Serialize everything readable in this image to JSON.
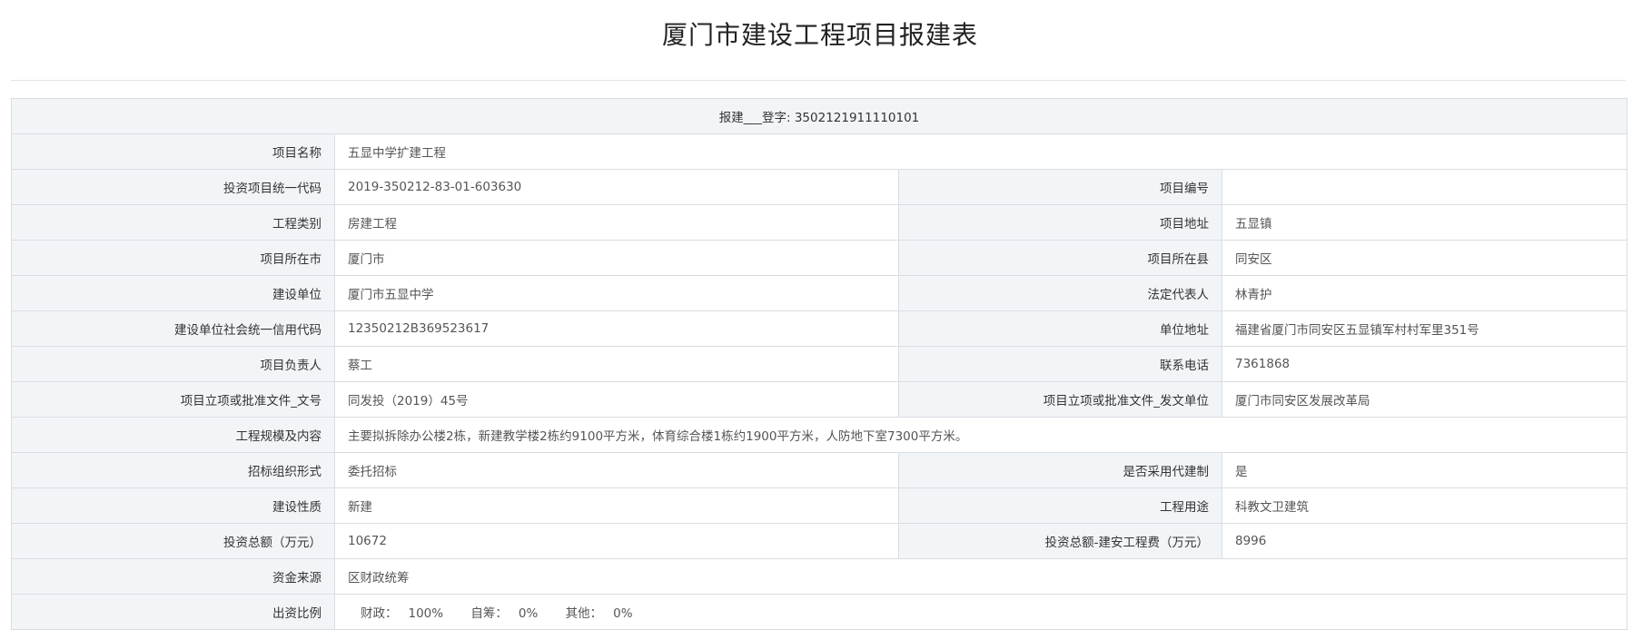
{
  "page": {
    "title": "厦门市建设工程项目报建表"
  },
  "form": {
    "header": "报建___登字: 3502121911110101",
    "rows_full": {
      "project_name": {
        "label": "项目名称",
        "value": "五显中学扩建工程"
      },
      "scale": {
        "label": "工程规模及内容",
        "value": "主要拟拆除办公楼2栋，新建教学楼2栋约9100平方米，体育综合楼1栋约1900平方米，人防地下室7300平方米。"
      },
      "fund_source": {
        "label": "资金来源",
        "value": "区财政统筹"
      }
    },
    "rows_split": [
      {
        "left_label": "投资项目统一代码",
        "left_value": "2019-350212-83-01-603630",
        "right_label": "项目编号",
        "right_value": ""
      },
      {
        "left_label": "工程类别",
        "left_value": "房建工程",
        "right_label": "项目地址",
        "right_value": "五显镇"
      },
      {
        "left_label": "项目所在市",
        "left_value": "厦门市",
        "right_label": "项目所在县",
        "right_value": "同安区"
      },
      {
        "left_label": "建设单位",
        "left_value": "厦门市五显中学",
        "right_label": "法定代表人",
        "right_value": "林青护"
      },
      {
        "left_label": "建设单位社会统一信用代码",
        "left_value": "12350212B369523617",
        "right_label": "单位地址",
        "right_value": "福建省厦门市同安区五显镇军村村军里351号"
      },
      {
        "left_label": "项目负责人",
        "left_value": "蔡工",
        "right_label": "联系电话",
        "right_value": "7361868"
      },
      {
        "left_label": "项目立项或批准文件_文号",
        "left_value": "同发投（2019）45号",
        "right_label": "项目立项或批准文件_发文单位",
        "right_value": "厦门市同安区发展改革局"
      },
      {
        "left_label": "招标组织形式",
        "left_value": "委托招标",
        "right_label": "是否采用代建制",
        "right_value": "是"
      },
      {
        "left_label": "建设性质",
        "left_value": "新建",
        "right_label": "工程用途",
        "right_value": "科教文卫建筑"
      },
      {
        "left_label": "投资总额（万元）",
        "left_value": "10672",
        "right_label": "投资总额-建安工程费（万元）",
        "right_value": "8996"
      }
    ],
    "funding_ratio": {
      "label": "出资比例",
      "finance_label": "财政：",
      "finance_value": "100%",
      "self_label": "自筹：",
      "self_value": "0%",
      "other_label": "其他：",
      "other_value": "0%"
    }
  }
}
